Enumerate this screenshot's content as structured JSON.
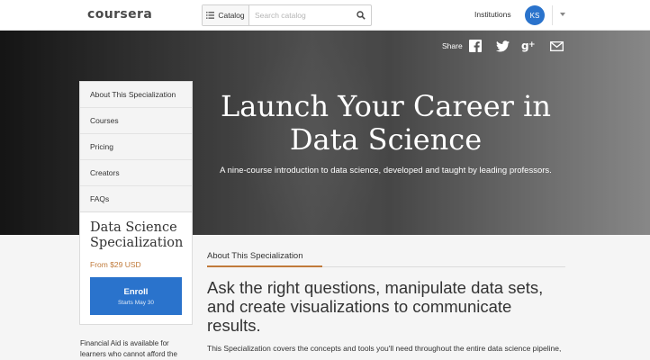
{
  "header": {
    "logo": "coursera",
    "catalog_label": "Catalog",
    "search_placeholder": "Search catalog",
    "institutions_label": "Institutions",
    "avatar_initials": "KS"
  },
  "hero": {
    "title": "Launch Your Career in Data Science",
    "subtitle": "A nine-course introduction to data science, developed and taught by leading professors.",
    "share_label": "Share",
    "share_icons": [
      "facebook-icon",
      "twitter-icon",
      "google-plus-icon",
      "email-icon"
    ]
  },
  "side_menu": {
    "items": [
      {
        "label": "About This Specialization"
      },
      {
        "label": "Courses"
      },
      {
        "label": "Pricing"
      },
      {
        "label": "Creators"
      },
      {
        "label": "FAQs"
      }
    ]
  },
  "price_card": {
    "title": "Data Science Specialization",
    "price": "From $29 USD",
    "enroll_label": "Enroll",
    "enroll_sub": "Starts May 30"
  },
  "financial_aid": "Financial Aid is available for learners who cannot afford the",
  "main": {
    "section_tab": "About This Specialization",
    "heading": "Ask the right questions, manipulate data sets, and create visualizations to communicate results.",
    "description": "This Specialization covers the concepts and tools you'll need throughout the entire data science pipeline,"
  },
  "colors": {
    "brand_blue": "#2a73cc",
    "accent_orange": "#c07a3a"
  }
}
